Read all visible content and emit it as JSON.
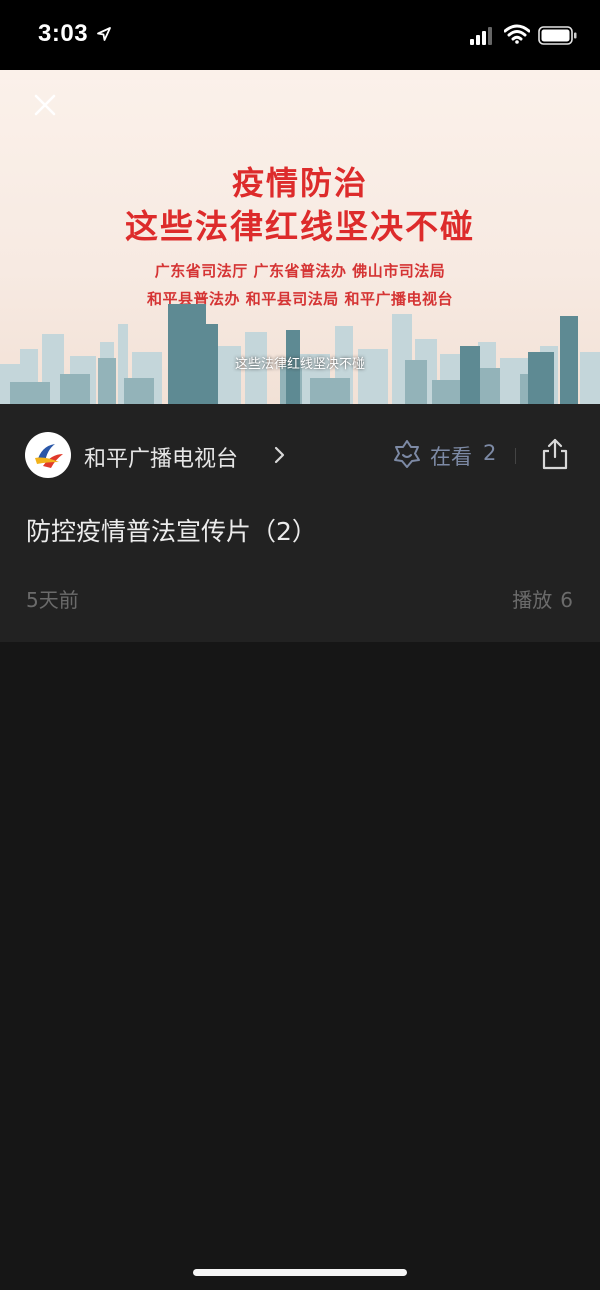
{
  "status_bar": {
    "time": "3:03"
  },
  "video": {
    "headline_line1": "疫情防治",
    "headline_line2": "这些法律红线坚决不碰",
    "org_line1": "广东省司法厅  广东省普法办  佛山市司法局",
    "org_line2": "和平县普法办  和平县司法局  和平广播电视台",
    "subtitle": "这些法律红线坚决不碰"
  },
  "info": {
    "channel_name": "和平广播电视台",
    "looking_label": "在看",
    "looking_count": "2",
    "title": "防控疫情普法宣传片（2）",
    "time_ago": "5天前",
    "plays_label": "播放",
    "plays_count": "6"
  },
  "colors": {
    "headline_red": "#dd2b2b",
    "looking_blue_gray": "#7d8aa5",
    "panel_bg": "#222222",
    "page_bg": "#161616"
  },
  "icons": [
    "location-arrow-icon",
    "signal-icon",
    "wifi-icon",
    "battery-icon",
    "close-icon",
    "chevron-right-icon",
    "looking-icon",
    "share-icon"
  ]
}
